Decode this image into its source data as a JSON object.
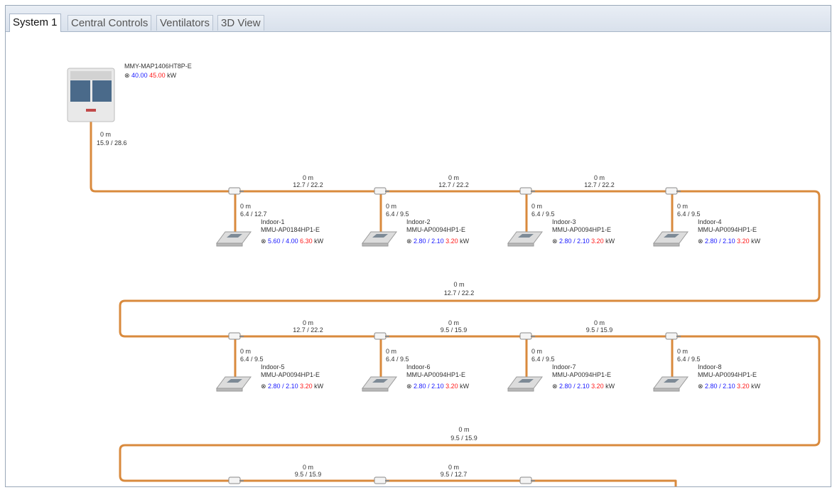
{
  "tabs": [
    {
      "label": "System 1",
      "active": true
    },
    {
      "label": "Central Controls",
      "active": false
    },
    {
      "label": "Ventilators",
      "active": false
    },
    {
      "label": "3D View",
      "active": false
    }
  ],
  "outdoor": {
    "model": "MMY-MAP1406HT8P-E",
    "cooling": "40.00",
    "heating": "45.00",
    "unit": "kW",
    "pipe_length": "0 m",
    "pipe_size": "15.9 / 28.6"
  },
  "indoors": [
    {
      "name": "Indoor-1",
      "model": "MMU-AP0184HP1-E",
      "cap1": "5.60",
      "cap2": "4.00",
      "cap3": "6.30",
      "unit": "kW",
      "drop_length": "0 m",
      "drop_size": "6.4 / 12.7"
    },
    {
      "name": "Indoor-2",
      "model": "MMU-AP0094HP1-E",
      "cap1": "2.80",
      "cap2": "2.10",
      "cap3": "3.20",
      "unit": "kW",
      "drop_length": "0 m",
      "drop_size": "6.4 / 9.5"
    },
    {
      "name": "Indoor-3",
      "model": "MMU-AP0094HP1-E",
      "cap1": "2.80",
      "cap2": "2.10",
      "cap3": "3.20",
      "unit": "kW",
      "drop_length": "0 m",
      "drop_size": "6.4 / 9.5"
    },
    {
      "name": "Indoor-4",
      "model": "MMU-AP0094HP1-E",
      "cap1": "2.80",
      "cap2": "2.10",
      "cap3": "3.20",
      "unit": "kW",
      "drop_length": "0 m",
      "drop_size": "6.4 / 9.5"
    },
    {
      "name": "Indoor-5",
      "model": "MMU-AP0094HP1-E",
      "cap1": "2.80",
      "cap2": "2.10",
      "cap3": "3.20",
      "unit": "kW",
      "drop_length": "0 m",
      "drop_size": "6.4 / 9.5"
    },
    {
      "name": "Indoor-6",
      "model": "MMU-AP0094HP1-E",
      "cap1": "2.80",
      "cap2": "2.10",
      "cap3": "3.20",
      "unit": "kW",
      "drop_length": "0 m",
      "drop_size": "6.4 / 9.5"
    },
    {
      "name": "Indoor-7",
      "model": "MMU-AP0094HP1-E",
      "cap1": "2.80",
      "cap2": "2.10",
      "cap3": "3.20",
      "unit": "kW",
      "drop_length": "0 m",
      "drop_size": "6.4 / 9.5"
    },
    {
      "name": "Indoor-8",
      "model": "MMU-AP0094HP1-E",
      "cap1": "2.80",
      "cap2": "2.10",
      "cap3": "3.20",
      "unit": "kW",
      "drop_length": "0 m",
      "drop_size": "6.4 / 9.5"
    }
  ],
  "row1_links": [
    {
      "length": "0 m",
      "size": "12.7 / 22.2"
    },
    {
      "length": "0 m",
      "size": "12.7 / 22.2"
    },
    {
      "length": "0 m",
      "size": "12.7 / 22.2"
    }
  ],
  "return1": {
    "length": "0 m",
    "size": "12.7 / 22.2"
  },
  "row2_links": [
    {
      "length": "0 m",
      "size": "12.7 / 22.2"
    },
    {
      "length": "0 m",
      "size": "9.5 / 15.9"
    },
    {
      "length": "0 m",
      "size": "9.5 / 15.9"
    }
  ],
  "return2": {
    "length": "0 m",
    "size": "9.5 / 15.9"
  },
  "row3_links": [
    {
      "length": "0 m",
      "size": "9.5 / 15.9"
    },
    {
      "length": "0 m",
      "size": "9.5 / 12.7"
    }
  ],
  "colors": {
    "pipe": "#d98a3d",
    "cooling": "#1a1aff",
    "heating": "#ff1a1a",
    "text": "#333333"
  },
  "icons": {
    "mode": "fan-icon",
    "joint": "refnet-joint-icon",
    "outdoor": "outdoor-unit-icon",
    "indoor": "cassette-unit-icon"
  }
}
